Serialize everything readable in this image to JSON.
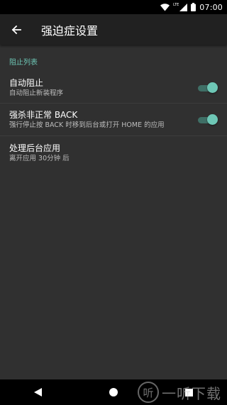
{
  "status_bar": {
    "network_label": "LTE",
    "time": "07:00",
    "icons": [
      "wifi-icon",
      "signal-icon",
      "battery-icon"
    ]
  },
  "toolbar": {
    "title": "强迫症设置",
    "back_icon": "arrow-left-icon"
  },
  "section": {
    "header": "阻止列表"
  },
  "preferences": [
    {
      "title": "自动阻止",
      "summary": "自动阻止新装程序",
      "switch_on": true
    },
    {
      "title": "强杀非正常 BACK",
      "summary": "强行停止按 BACK 时移到后台或打开 HOME 的应用",
      "switch_on": true
    },
    {
      "title": "处理后台应用",
      "summary": "离开应用 30分钟 后"
    }
  ],
  "nav_bar": {
    "icons": [
      "back-triangle-icon",
      "home-circle-icon",
      "recents-square-icon"
    ]
  },
  "watermark": {
    "circle_text": "听",
    "text": "一听下载"
  },
  "colors": {
    "accent": "#6ec7b6",
    "background": "#303030",
    "toolbar": "#212121"
  }
}
